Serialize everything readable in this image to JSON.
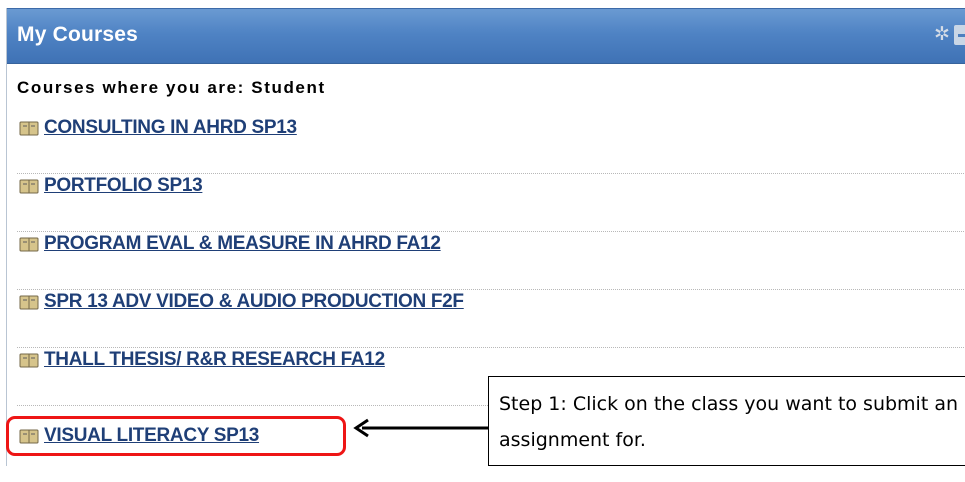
{
  "module": {
    "title": "My Courses",
    "gear_icon": "gear-icon",
    "minimize_icon": "minimize-icon"
  },
  "section": {
    "heading": "Courses where you are: Student"
  },
  "courses": [
    {
      "label": "CONSULTING IN AHRD SP13",
      "icon": "course-book-icon"
    },
    {
      "label": "PORTFOLIO SP13",
      "icon": "course-book-icon"
    },
    {
      "label": "PROGRAM EVAL & MEASURE IN AHRD FA12",
      "icon": "course-book-icon"
    },
    {
      "label": "SPR 13 ADV VIDEO & AUDIO PRODUCTION F2F",
      "icon": "course-book-icon"
    },
    {
      "label": "THALL THESIS/ R&R RESEARCH FA12",
      "icon": "course-book-icon"
    },
    {
      "label": "VISUAL LITERACY SP13",
      "icon": "course-book-icon"
    }
  ],
  "callout": {
    "text": "Step 1: Click on the class you want to submit an assignment for."
  },
  "colors": {
    "header": "#4f83c4",
    "link": "#1f3f77",
    "highlight": "#ee1515"
  }
}
